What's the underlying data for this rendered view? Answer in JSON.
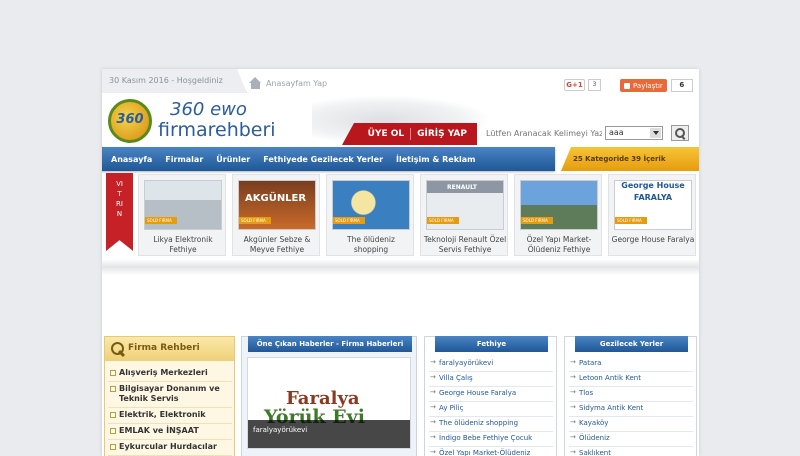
{
  "topbar": {
    "date": "30 Kasım 2016 - Hoşgeldiniz",
    "home_label": "Anasayfam Yap",
    "gplus_label": "G+1",
    "gplus_count": "3",
    "share_label": "Paylaştır",
    "share_count": "6"
  },
  "header": {
    "logo_badge": "360",
    "logo_line1": "360 ewo",
    "logo_line2a": "firma",
    "logo_line2b": "rehberi",
    "member": {
      "signup": "ÜYE OL",
      "login": "GİRİŞ YAP"
    },
    "search": {
      "placeholder": "Lütfen Aranacak Kelimeyi Yazınız",
      "select_value": "aaa"
    }
  },
  "nav": {
    "items": [
      {
        "label": "Anasayfa"
      },
      {
        "label": "Firmalar"
      },
      {
        "label": "Ürünler"
      },
      {
        "label": "Fethiyede Gezilecek Yerler"
      },
      {
        "label": "İletişim & Reklam"
      }
    ],
    "category_count": "25 Kategoride 39 İçerik"
  },
  "vitrin": {
    "ribbon": "VITRIN",
    "badge": "SOLD FIRMA",
    "items": [
      {
        "label": "Likya Elektronik Fethiye"
      },
      {
        "label": "Akgünler Sebze & Meyve Fethiye"
      },
      {
        "label": "The ölüdeniz shopping"
      },
      {
        "label": "Teknoloji Renault Özel Servis Fethiye"
      },
      {
        "label": "Özel Yapı Market-Ölüdeniz Fethiye"
      },
      {
        "label": "George House Faralya"
      }
    ],
    "thumb_texts": {
      "akgunler": "AKGÜNLER",
      "renault": "RENAULT",
      "george": "George House FARALYA"
    }
  },
  "firma_rehberi": {
    "title": "Firma Rehberi",
    "items": [
      {
        "label": "Alışveriş Merkezleri"
      },
      {
        "label": "Bilgisayar Donanım ve Teknik Servis"
      },
      {
        "label": "Elektrik, Elektronik"
      },
      {
        "label": "EMLAK ve İNŞAAT"
      },
      {
        "label": "Eykurcular Hurdacılar"
      }
    ]
  },
  "haberler": {
    "title": "Öne Çıkan Haberler - Firma Haberleri",
    "image_text1": "Faralya",
    "image_text2": "Yörük Evi",
    "caption": "faralyayörükevi"
  },
  "fethiye": {
    "title": "Fethiye",
    "items": [
      {
        "label": "faralyayörükevi"
      },
      {
        "label": "Villa Çalış"
      },
      {
        "label": "George House Faralya"
      },
      {
        "label": "Ay Piliç"
      },
      {
        "label": "The ölüdeniz shopping"
      },
      {
        "label": "İndigo Bebe Fethiye Çocuk"
      },
      {
        "label": "Özel Yapı Market-Ölüdeniz"
      }
    ]
  },
  "gezilecek": {
    "title": "Gezilecek Yerler",
    "items": [
      {
        "label": "Patara"
      },
      {
        "label": "Letoon Antik Kent"
      },
      {
        "label": "Tlos"
      },
      {
        "label": "Sidyma Antik Kent"
      },
      {
        "label": "Kayaköy"
      },
      {
        "label": "Ölüdeniz"
      },
      {
        "label": "Saklıkent"
      }
    ]
  }
}
